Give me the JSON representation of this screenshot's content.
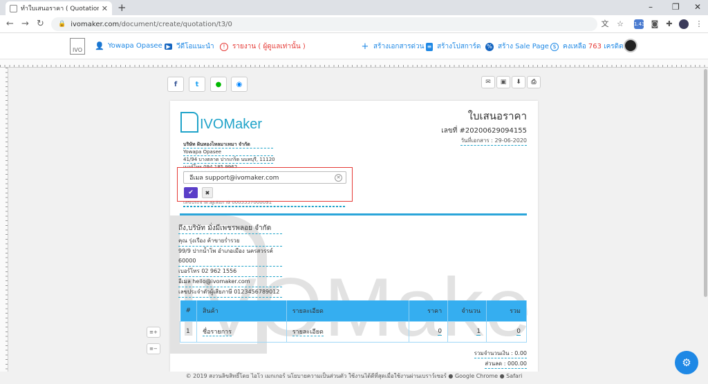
{
  "browser": {
    "tab_title": "ทำใบเสนอราคา ( Quotation ) ออนไล",
    "url_host": "ivomaker.com",
    "url_path": "/document/create/quotation/t3/0",
    "extension_badge": "1.43"
  },
  "header": {
    "logo_text": "IVO",
    "user_name": "Yowapa Opasee",
    "video_guide": "วีดีโอแนะนำ",
    "report": "รายงาน ( ผู้ดูแลเท่านั้น )",
    "quick_doc": "สร้างเอกสารด่วน",
    "create_poster": "สร้างโปสการ์ด",
    "create_sale_page": "สร้าง Sale Page",
    "credit_prefix": "คงเหลือ",
    "credit_value": "763",
    "credit_suffix": "เครดิต"
  },
  "document": {
    "brand": "IVOMaker",
    "watermark": "IVOMaker",
    "title": "ใบเสนอราคา",
    "number_label": "เลขที่",
    "number": "#20200629094155",
    "date": "วันที่เอกสาร : 29-06-2020",
    "company": {
      "name": "บริษัท ฝันทองไหลมาเทมา จำกัด",
      "contact": "Yowapa Opasee",
      "address": "41/94 บางตลาด ปากเกร็ด นนทบุรี, 11120",
      "phone": "เบอร์โทร 094 185 9962",
      "tax_id": "เลขประจำตัวผู้เสียภาษี 0005557000091"
    },
    "email_edit": {
      "value": "อีเมล support@ivomaker.com"
    },
    "customer": {
      "name": "ถึง,บริษัท มั่งมีเพชรพลอย จำกัด",
      "contact": "คุณ รุ่งเรือง ค้าขายร่ำรวย",
      "address": "99/9 ปากน้ำโพ อำเภอเมือง นครสวรรค์ 60000",
      "phone": "เบอร์โทร 02 962 1556",
      "email": "อีเมล hello@ivomaker.com",
      "tax_id": "เลขประจำตัวผู้เสียภาษี 0123456789012"
    },
    "table": {
      "headers": [
        "#",
        "สินค้า",
        "รายละเอียด",
        "ราคา",
        "จำนวน",
        "รวม"
      ],
      "rows": [
        [
          "1",
          "ชื่อรายการ",
          "รายละเอียด",
          "0",
          "1",
          "0"
        ]
      ]
    },
    "subtotal": "รวมจำนวนเงิน : 0.00",
    "discount": "ส่วนลด : 000.00"
  },
  "footer": "© 2019 สงวนลิขสิทธิ์โดย ไอโว เมกเกอร์ นโยบายความเป็นส่วนตัว ใช้งานได้ดีที่สุดเมื่อใช้งานผ่านเบราว์เซอร์ ● Google Chrome ● Safari"
}
